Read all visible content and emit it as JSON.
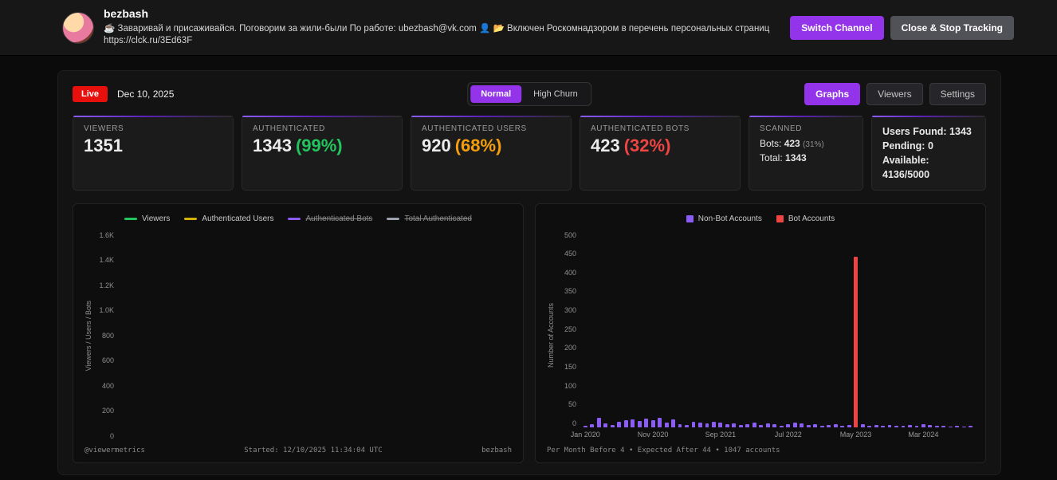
{
  "header": {
    "channel_name": "bezbash",
    "description": "☕ Заваривай и присаживайся. Поговорим за жили-были По работе: ubezbash@vk.com 👤 📂 Включен Роскомнадзором в перечень персональных страниц",
    "link": "https://clck.ru/3Ed63F",
    "switch_channel_label": "Switch Channel",
    "close_stop_label": "Close & Stop Tracking"
  },
  "toolbar": {
    "live_label": "Live",
    "date": "Dec 10, 2025",
    "mode_normal_label": "Normal",
    "mode_high_churn_label": "High Churn",
    "tab_graphs_label": "Graphs",
    "tab_viewers_label": "Viewers",
    "tab_settings_label": "Settings"
  },
  "stats": {
    "viewers": {
      "label": "VIEWERS",
      "value": "1351"
    },
    "authenticated": {
      "label": "AUTHENTICATED",
      "value": "1343",
      "percent": "(99%)"
    },
    "authenticated_users": {
      "label": "AUTHENTICATED USERS",
      "value": "920",
      "percent": "(68%)"
    },
    "authenticated_bots": {
      "label": "AUTHENTICATED BOTS",
      "value": "423",
      "percent": "(32%)"
    },
    "scanned": {
      "label": "SCANNED",
      "bots_label": "Bots:",
      "bots_value": "423",
      "bots_percent": "(31%)",
      "total_label": "Total:",
      "total_value": "1343"
    },
    "summary": {
      "users_found_label": "Users Found:",
      "users_found_value": "1343",
      "pending_label": "Pending:",
      "pending_value": "0",
      "available_label": "Available:",
      "available_value": "4136/5000"
    }
  },
  "left_chart": {
    "footer_left": "@viewermetrics",
    "footer_center": "Started: 12/10/2025 11:34:04 UTC",
    "footer_right": "bezbash"
  },
  "right_chart": {
    "footer": "Per Month Before 4 • Expected After 44 • 1047 accounts"
  },
  "chart_data": [
    {
      "name": "viewers-timeline",
      "type": "line",
      "ylabel": "Viewers / Users / Bots",
      "ylim": [
        0,
        1600
      ],
      "yticks": [
        "1.6K",
        "1.4K",
        "1.2K",
        "1.0K",
        "800",
        "600",
        "400",
        "200",
        "0"
      ],
      "x": [],
      "legend_position": "top",
      "grid": false,
      "series": [
        {
          "name": "Viewers",
          "color": "#22c55e",
          "hidden": false,
          "values": []
        },
        {
          "name": "Authenticated Users",
          "color": "#d4b106",
          "hidden": false,
          "values": []
        },
        {
          "name": "Authenticated Bots",
          "color": "#8b5cf6",
          "hidden": true,
          "values": []
        },
        {
          "name": "Total Authenticated",
          "color": "#9ca3af",
          "hidden": true,
          "values": []
        }
      ]
    },
    {
      "name": "account-creation-dates",
      "type": "bar",
      "ylabel": "Number of Accounts",
      "ylim": [
        0,
        500
      ],
      "yticks": [
        "500",
        "450",
        "400",
        "350",
        "300",
        "250",
        "200",
        "150",
        "100",
        "50",
        "0"
      ],
      "months": 58,
      "x_start": "Jan 2020",
      "x_tick_indices": [
        0,
        10,
        20,
        30,
        40,
        50
      ],
      "x_tick_labels": [
        "Jan 2020",
        "Nov 2020",
        "Sep 2021",
        "Jul 2022",
        "May 2023",
        "Mar 2024"
      ],
      "legend_position": "top",
      "grid": false,
      "series": [
        {
          "name": "Non-Bot Accounts",
          "color": "#8b5cf6",
          "hidden": false,
          "values": [
            5,
            8,
            25,
            10,
            6,
            14,
            18,
            20,
            16,
            22,
            18,
            25,
            12,
            20,
            8,
            6,
            15,
            12,
            10,
            14,
            12,
            8,
            10,
            6,
            8,
            12,
            6,
            10,
            8,
            5,
            8,
            12,
            10,
            6,
            8,
            5,
            6,
            8,
            5,
            7,
            0,
            8,
            5,
            6,
            4,
            6,
            5,
            4,
            6,
            5,
            8,
            6,
            4,
            5,
            3,
            4,
            3,
            4
          ]
        },
        {
          "name": "Bot Accounts",
          "color": "#ef4444",
          "hidden": false,
          "values": [
            0,
            0,
            0,
            0,
            0,
            0,
            0,
            0,
            0,
            0,
            0,
            0,
            0,
            0,
            0,
            0,
            0,
            0,
            0,
            0,
            0,
            0,
            0,
            0,
            0,
            0,
            0,
            0,
            0,
            0,
            0,
            0,
            0,
            0,
            0,
            0,
            0,
            0,
            0,
            0,
            435,
            0,
            0,
            0,
            0,
            0,
            0,
            0,
            0,
            0,
            0,
            0,
            0,
            0,
            0,
            0,
            0,
            0
          ]
        }
      ]
    }
  ]
}
